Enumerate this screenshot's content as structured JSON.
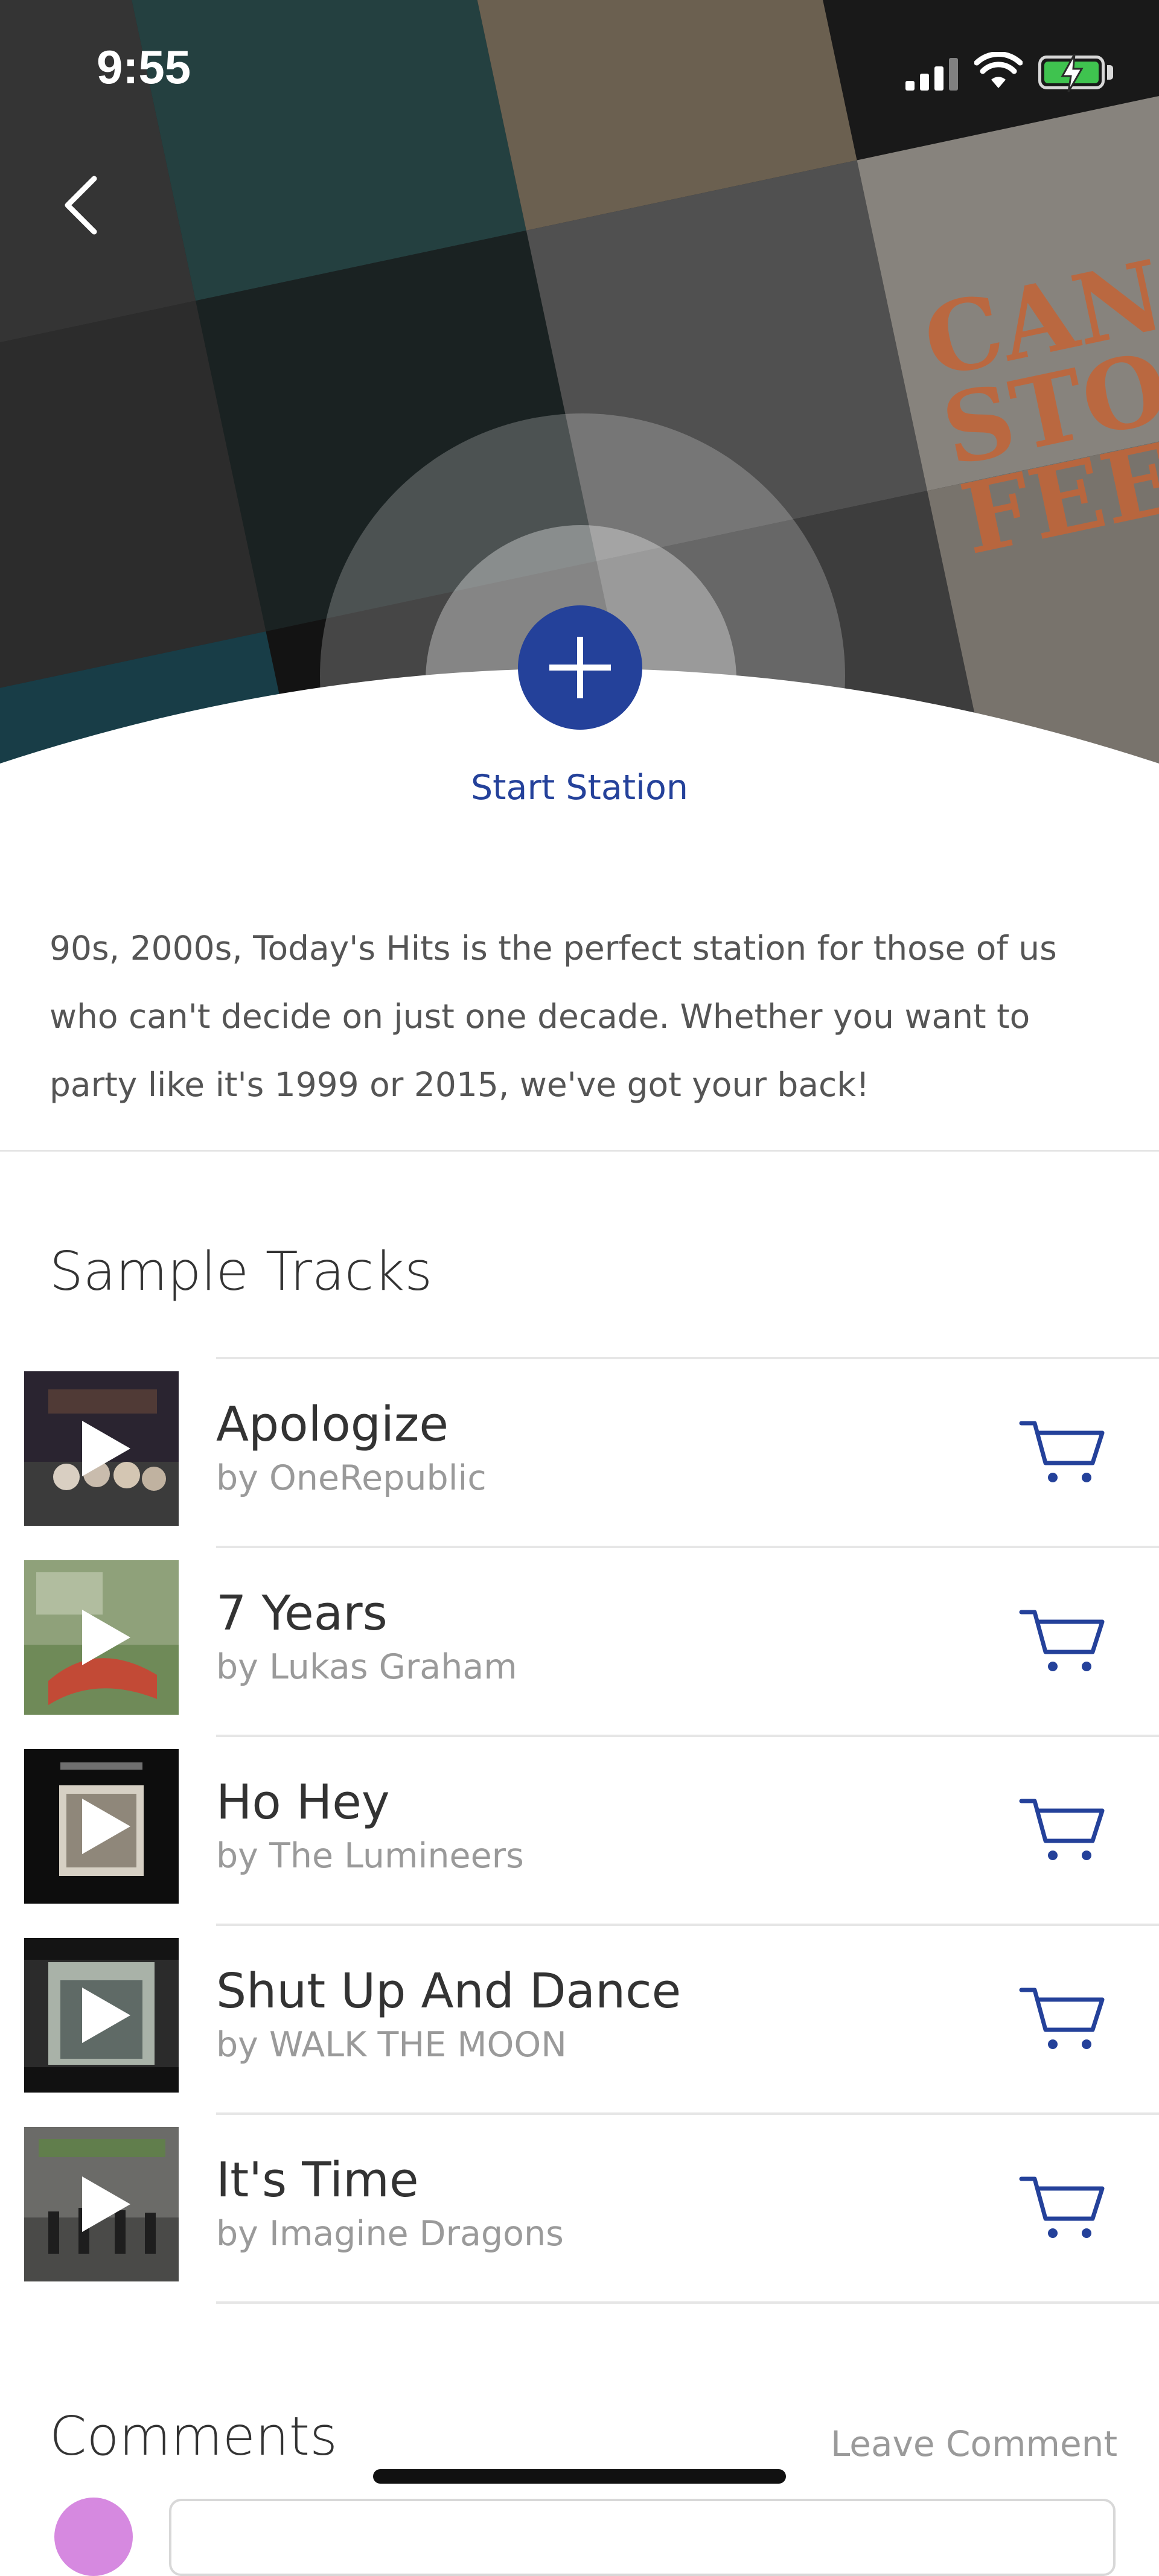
{
  "status_bar": {
    "time": "9:55"
  },
  "hero": {
    "start_label": "Start Station"
  },
  "description": "90s, 2000s, Today's Hits is the perfect station for those of us who can't decide on just one decade. Whether you want to party like it's 1999 or 2015, we've got your back!",
  "sample_tracks": {
    "heading": "Sample Tracks",
    "items": [
      {
        "title": "Apologize",
        "artist": "by OneRepublic"
      },
      {
        "title": "7 Years",
        "artist": "by Lukas Graham"
      },
      {
        "title": "Ho Hey",
        "artist": "by The Lumineers"
      },
      {
        "title": "Shut Up And Dance",
        "artist": "by WALK THE MOON"
      },
      {
        "title": "It's Time",
        "artist": "by Imagine Dragons"
      }
    ]
  },
  "comments": {
    "heading": "Comments",
    "leave_label": "Leave Comment"
  },
  "colors": {
    "accent": "#24419a",
    "muted": "#9a9a9a",
    "battery": "#3fc34f"
  },
  "icons": [
    "back-chevron-icon",
    "plus-icon",
    "play-icon",
    "cart-icon",
    "wifi-icon",
    "signal-icon",
    "battery-icon"
  ]
}
